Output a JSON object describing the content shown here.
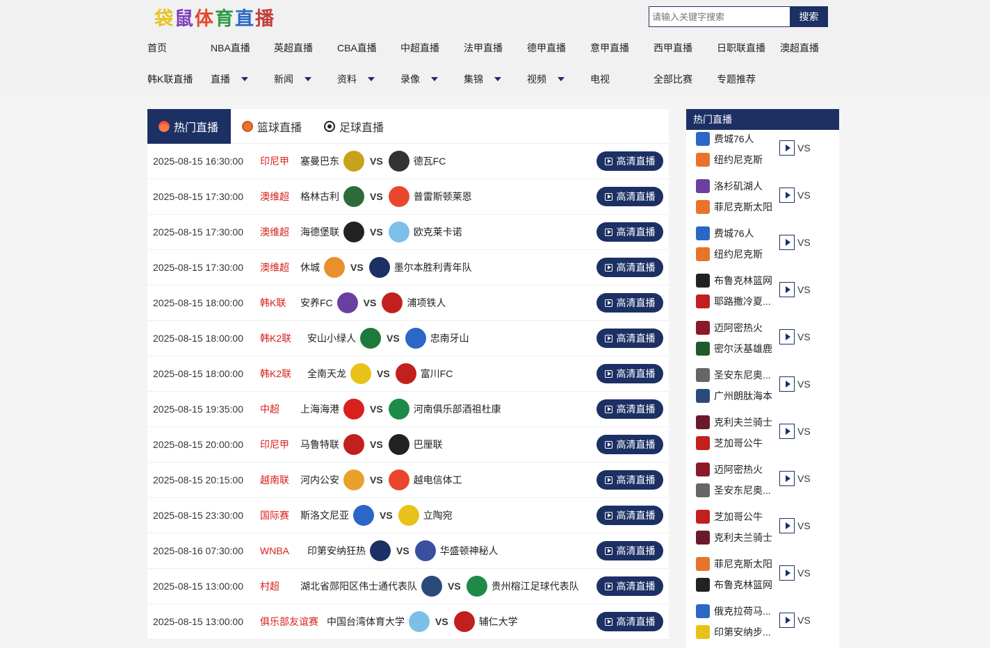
{
  "site": {
    "logo_chars": [
      "袋",
      "鼠",
      "体",
      "育",
      "直",
      "播"
    ]
  },
  "search": {
    "placeholder": "请输入关键字搜索",
    "button": "搜索"
  },
  "nav_row1": [
    "首页",
    "NBA直播",
    "英超直播",
    "CBA直播",
    "中超直播",
    "法甲直播",
    "德甲直播",
    "意甲直播",
    "西甲直播",
    "日职联直播",
    "澳超直播"
  ],
  "nav_row2": [
    {
      "label": "韩K联直播",
      "caret": false
    },
    {
      "label": "直播",
      "caret": true
    },
    {
      "label": "新闻",
      "caret": true
    },
    {
      "label": "资料",
      "caret": true
    },
    {
      "label": "录像",
      "caret": true
    },
    {
      "label": "集锦",
      "caret": true
    },
    {
      "label": "视频",
      "caret": true
    },
    {
      "label": "电视",
      "caret": false
    },
    {
      "label": "全部比赛",
      "caret": false
    },
    {
      "label": "专题推荐",
      "caret": false
    }
  ],
  "tabs": [
    {
      "label": "热门直播",
      "icon": "fire-icon"
    },
    {
      "label": "篮球直播",
      "icon": "basketball-icon"
    },
    {
      "label": "足球直播",
      "icon": "football-icon"
    }
  ],
  "live_label": "高清直播",
  "vs_label": "VS",
  "matches": [
    {
      "time": "2025-08-15 16:30:00",
      "league": "印尼甲",
      "home": "塞曼巴东",
      "away": "德瓦FC",
      "hc": "#c8a21a",
      "ac": "#333333"
    },
    {
      "time": "2025-08-15 17:30:00",
      "league": "澳维超",
      "home": "格林古利",
      "away": "普雷斯顿莱恩",
      "hc": "#2e6b3a",
      "ac": "#e8472b"
    },
    {
      "time": "2025-08-15 17:30:00",
      "league": "澳维超",
      "home": "海德堡联",
      "away": "欧克莱卡诺",
      "hc": "#222222",
      "ac": "#7cc0e8"
    },
    {
      "time": "2025-08-15 17:30:00",
      "league": "澳维超",
      "home": "休城",
      "away": "墨尔本胜利青年队",
      "hc": "#e8902b",
      "ac": "#1c3064"
    },
    {
      "time": "2025-08-15 18:00:00",
      "league": "韩K联",
      "home": "安养FC",
      "away": "浦项铁人",
      "hc": "#6a3fa0",
      "ac": "#c2201e"
    },
    {
      "time": "2025-08-15 18:00:00",
      "league": "韩K2联",
      "home": "安山小绿人",
      "away": "忠南牙山",
      "hc": "#1e7a3a",
      "ac": "#2a67c6"
    },
    {
      "time": "2025-08-15 18:00:00",
      "league": "韩K2联",
      "home": "全南天龙",
      "away": "富川FC",
      "hc": "#e8c21a",
      "ac": "#c2201e"
    },
    {
      "time": "2025-08-15 19:35:00",
      "league": "中超",
      "home": "上海海港",
      "away": "河南俱乐部酒祖杜康",
      "hc": "#d8201e",
      "ac": "#1e8a4a"
    },
    {
      "time": "2025-08-15 20:00:00",
      "league": "印尼甲",
      "home": "马鲁特联",
      "away": "巴厘联",
      "hc": "#c2201e",
      "ac": "#222222"
    },
    {
      "time": "2025-08-15 20:15:00",
      "league": "越南联",
      "home": "河内公安",
      "away": "越电信体工",
      "hc": "#e8a22b",
      "ac": "#e8472b"
    },
    {
      "time": "2025-08-15 23:30:00",
      "league": "国际赛",
      "home": "斯洛文尼亚",
      "away": "立陶宛",
      "hc": "#2a67c6",
      "ac": "#e8c21a"
    },
    {
      "time": "2025-08-16 07:30:00",
      "league": "WNBA",
      "home": "印第安纳狂热",
      "away": "华盛顿神秘人",
      "hc": "#1c3064",
      "ac": "#3a4fa0"
    },
    {
      "time": "2025-08-15 13:00:00",
      "league": "村超",
      "home": "湖北省郧阳区伟士通代表队",
      "away": "贵州榕江足球代表队",
      "hc": "#2a4a7a",
      "ac": "#1e8a4a"
    },
    {
      "time": "2025-08-15 13:00:00",
      "league": "俱乐部友谊赛",
      "home": "中国台湾体育大学",
      "away": "辅仁大学",
      "hc": "#7cc0e8",
      "ac": "#c2201e"
    }
  ],
  "side": {
    "title": "热门直播",
    "pairs": [
      {
        "a": "费城76人",
        "b": "纽约尼克斯",
        "ac": "#2a67c6",
        "bc": "#e8742b"
      },
      {
        "a": "洛杉矶湖人",
        "b": "菲尼克斯太阳",
        "ac": "#6a3fa0",
        "bc": "#e8742b"
      },
      {
        "a": "费城76人",
        "b": "纽约尼克斯",
        "ac": "#2a67c6",
        "bc": "#e8742b"
      },
      {
        "a": "布鲁克林篮网",
        "b": "耶路撒冷夏...",
        "ac": "#222222",
        "bc": "#c2201e"
      },
      {
        "a": "迈阿密热火",
        "b": "密尔沃基雄鹿",
        "ac": "#8a1a2a",
        "bc": "#1e5a2a"
      },
      {
        "a": "圣安东尼奥...",
        "b": "广州朗肽海本",
        "ac": "#666666",
        "bc": "#2a4a7a"
      },
      {
        "a": "克利夫兰骑士",
        "b": "芝加哥公牛",
        "ac": "#6a1a2a",
        "bc": "#c2201e"
      },
      {
        "a": "迈阿密热火",
        "b": "圣安东尼奥...",
        "ac": "#8a1a2a",
        "bc": "#666666"
      },
      {
        "a": "芝加哥公牛",
        "b": "克利夫兰骑士",
        "ac": "#c2201e",
        "bc": "#6a1a2a"
      },
      {
        "a": "菲尼克斯太阳",
        "b": "布鲁克林篮网",
        "ac": "#e8742b",
        "bc": "#222222"
      },
      {
        "a": "俄克拉荷马...",
        "b": "印第安纳步...",
        "ac": "#2a67c6",
        "bc": "#e8c21a"
      }
    ]
  }
}
